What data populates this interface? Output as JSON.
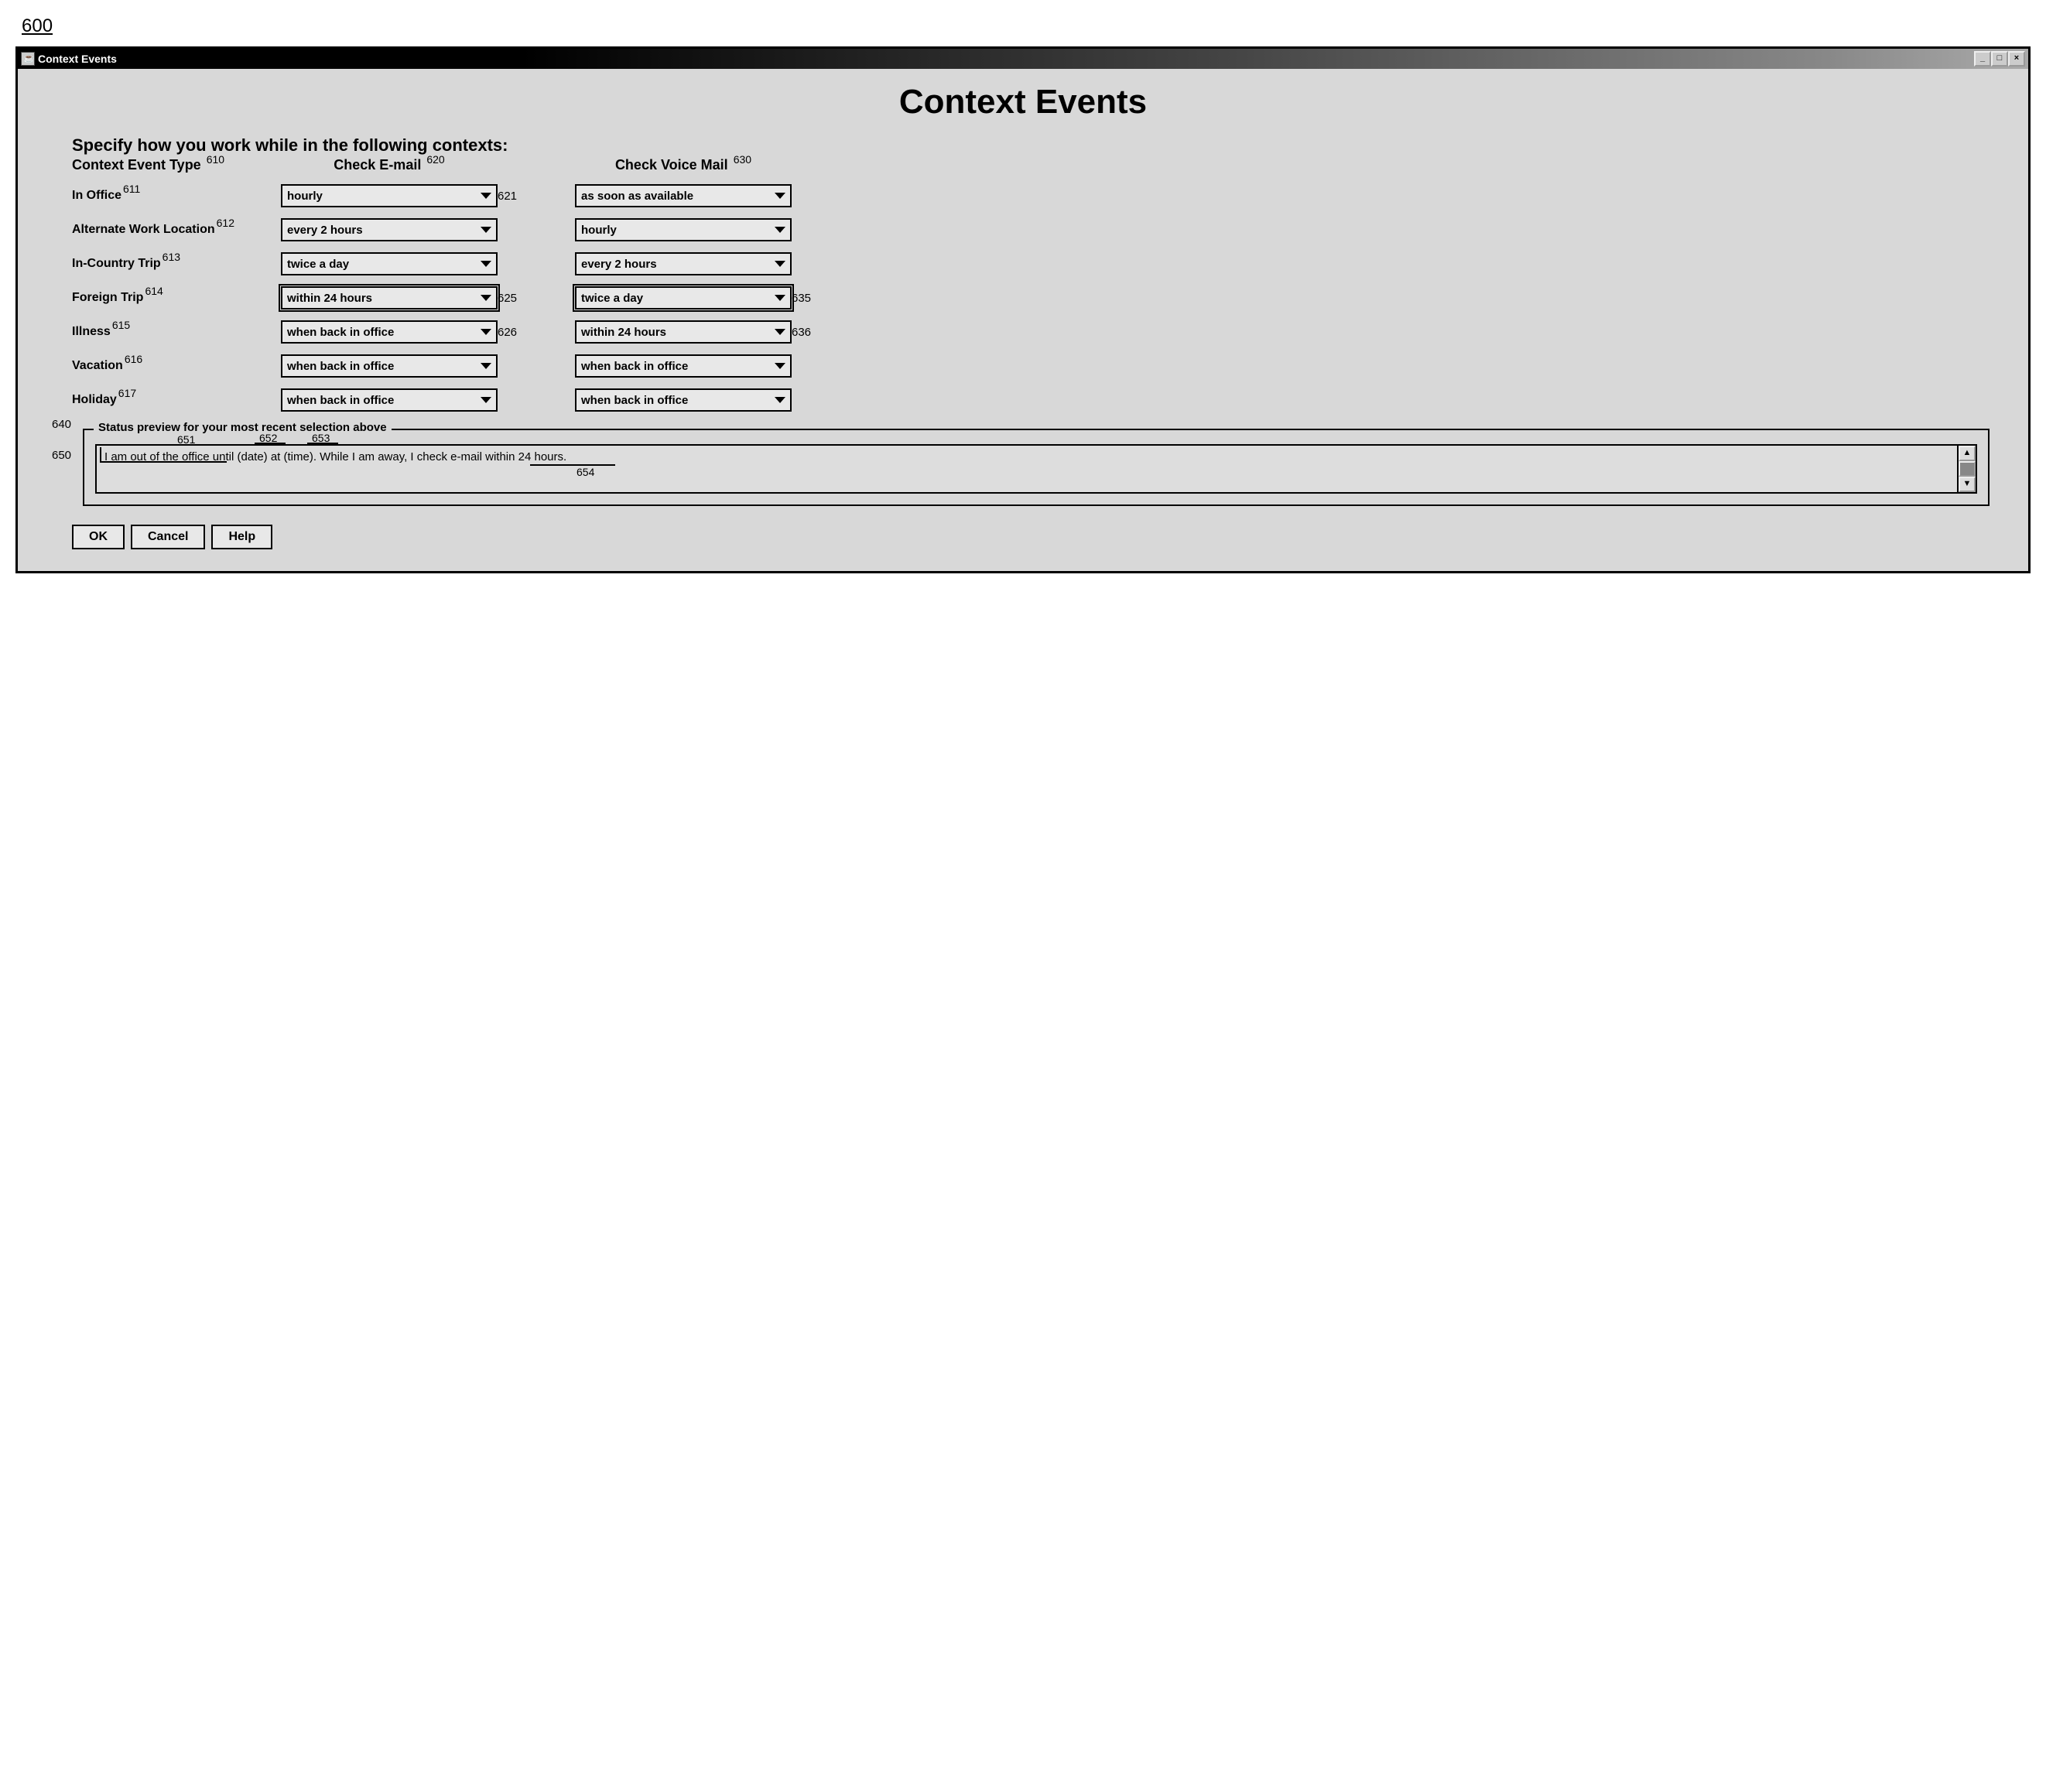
{
  "figure_ref": "600",
  "window": {
    "title": "Context Events",
    "controls": {
      "min": "_",
      "max": "□",
      "close": "×"
    }
  },
  "page_title": "Context Events",
  "instruction": "Specify how you work while in the following contexts:",
  "columns": {
    "context": {
      "label": "Context Event Type",
      "ref": "610"
    },
    "email": {
      "label": "Check E-mail",
      "ref": "620"
    },
    "voice": {
      "label": "Check Voice Mail",
      "ref": "630"
    }
  },
  "rows": [
    {
      "label": "In Office",
      "ref": "611",
      "email": "hourly",
      "email_ref": "621",
      "voice": "as soon as available",
      "voice_ref": ""
    },
    {
      "label": "Alternate Work Location",
      "ref": "612",
      "email": "every 2 hours",
      "email_ref": "",
      "voice": "hourly",
      "voice_ref": ""
    },
    {
      "label": "In-Country Trip",
      "ref": "613",
      "email": "twice a day",
      "email_ref": "",
      "voice": "every 2 hours",
      "voice_ref": ""
    },
    {
      "label": "Foreign Trip",
      "ref": "614",
      "email": "within 24 hours",
      "email_ref": "625",
      "voice": "twice a day",
      "voice_ref": "635",
      "dbl": true
    },
    {
      "label": "Illness",
      "ref": "615",
      "email": "when back in office",
      "email_ref": "626",
      "voice": "within 24 hours",
      "voice_ref": "636"
    },
    {
      "label": "Vacation",
      "ref": "616",
      "email": "when back in office",
      "email_ref": "",
      "voice": "when back in office",
      "voice_ref": ""
    },
    {
      "label": "Holiday",
      "ref": "617",
      "email": "when back in office",
      "email_ref": "",
      "voice": "when back in office",
      "voice_ref": ""
    }
  ],
  "preview": {
    "ref_group": "640",
    "ref_box": "650",
    "legend": "Status preview for your most recent selection above",
    "text": "I am out of the office until (date) at (time).  While I am away, I check e-mail within 24 hours.",
    "ann": {
      "a": "651",
      "b": "652",
      "c": "653",
      "d": "654"
    }
  },
  "buttons": {
    "ok": "OK",
    "cancel": "Cancel",
    "help": "Help"
  }
}
